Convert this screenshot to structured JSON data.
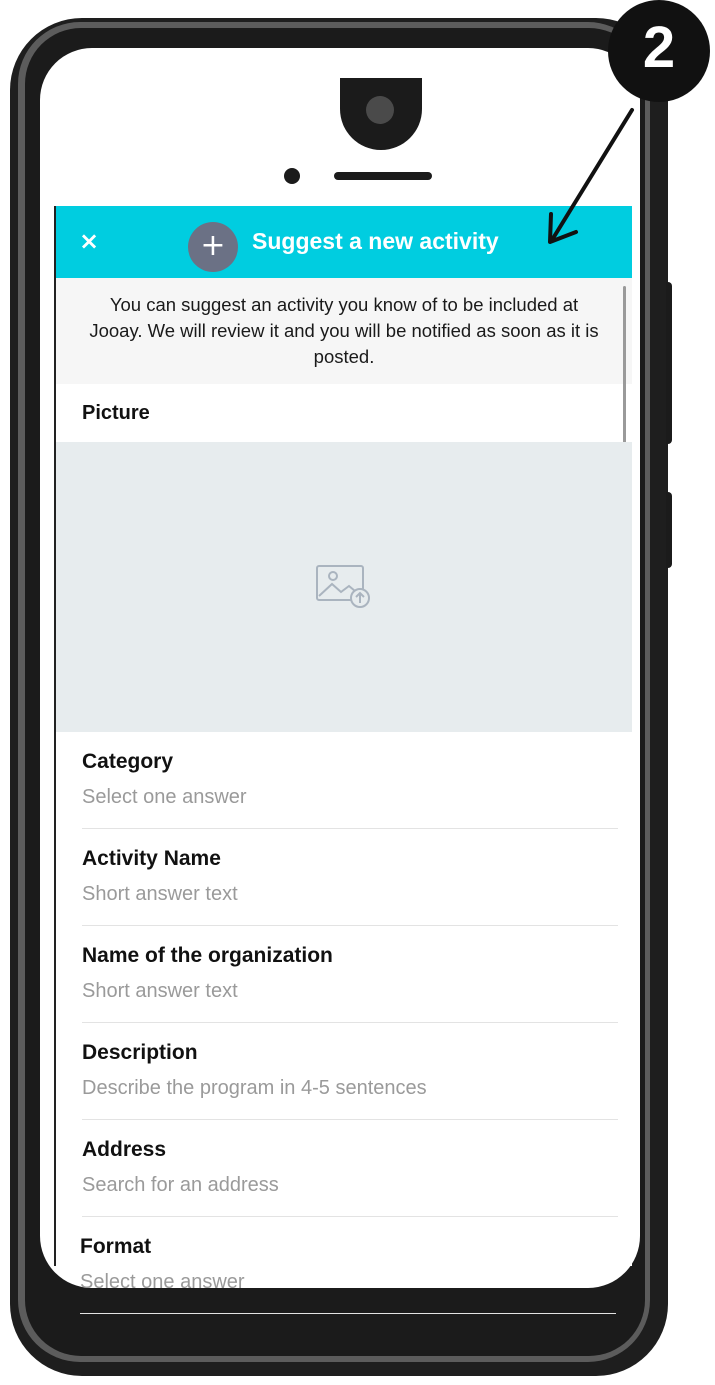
{
  "annotation": {
    "step_number": "2"
  },
  "header": {
    "close_icon": "×",
    "add_icon": "+",
    "title": "Suggest a new activity"
  },
  "intro": {
    "text": "You can suggest an activity you know of to be included at Jooay. We will review it and you will be notified as soon as it is posted."
  },
  "picture": {
    "label": "Picture",
    "icon": "image-upload-icon"
  },
  "fields": [
    {
      "label": "Category",
      "placeholder": "Select one answer"
    },
    {
      "label": "Activity Name",
      "placeholder": "Short answer text"
    },
    {
      "label": "Name of the organization",
      "placeholder": "Short answer text"
    },
    {
      "label": "Description",
      "placeholder": "Describe the program in 4-5 sentences"
    },
    {
      "label": "Address",
      "placeholder": "Search for an address"
    },
    {
      "label": "Format",
      "placeholder": "Select one answer"
    }
  ],
  "colors": {
    "header_bg": "#00cde0",
    "plus_circle_bg": "#6b7185",
    "picture_area_bg": "#e7ecee"
  }
}
